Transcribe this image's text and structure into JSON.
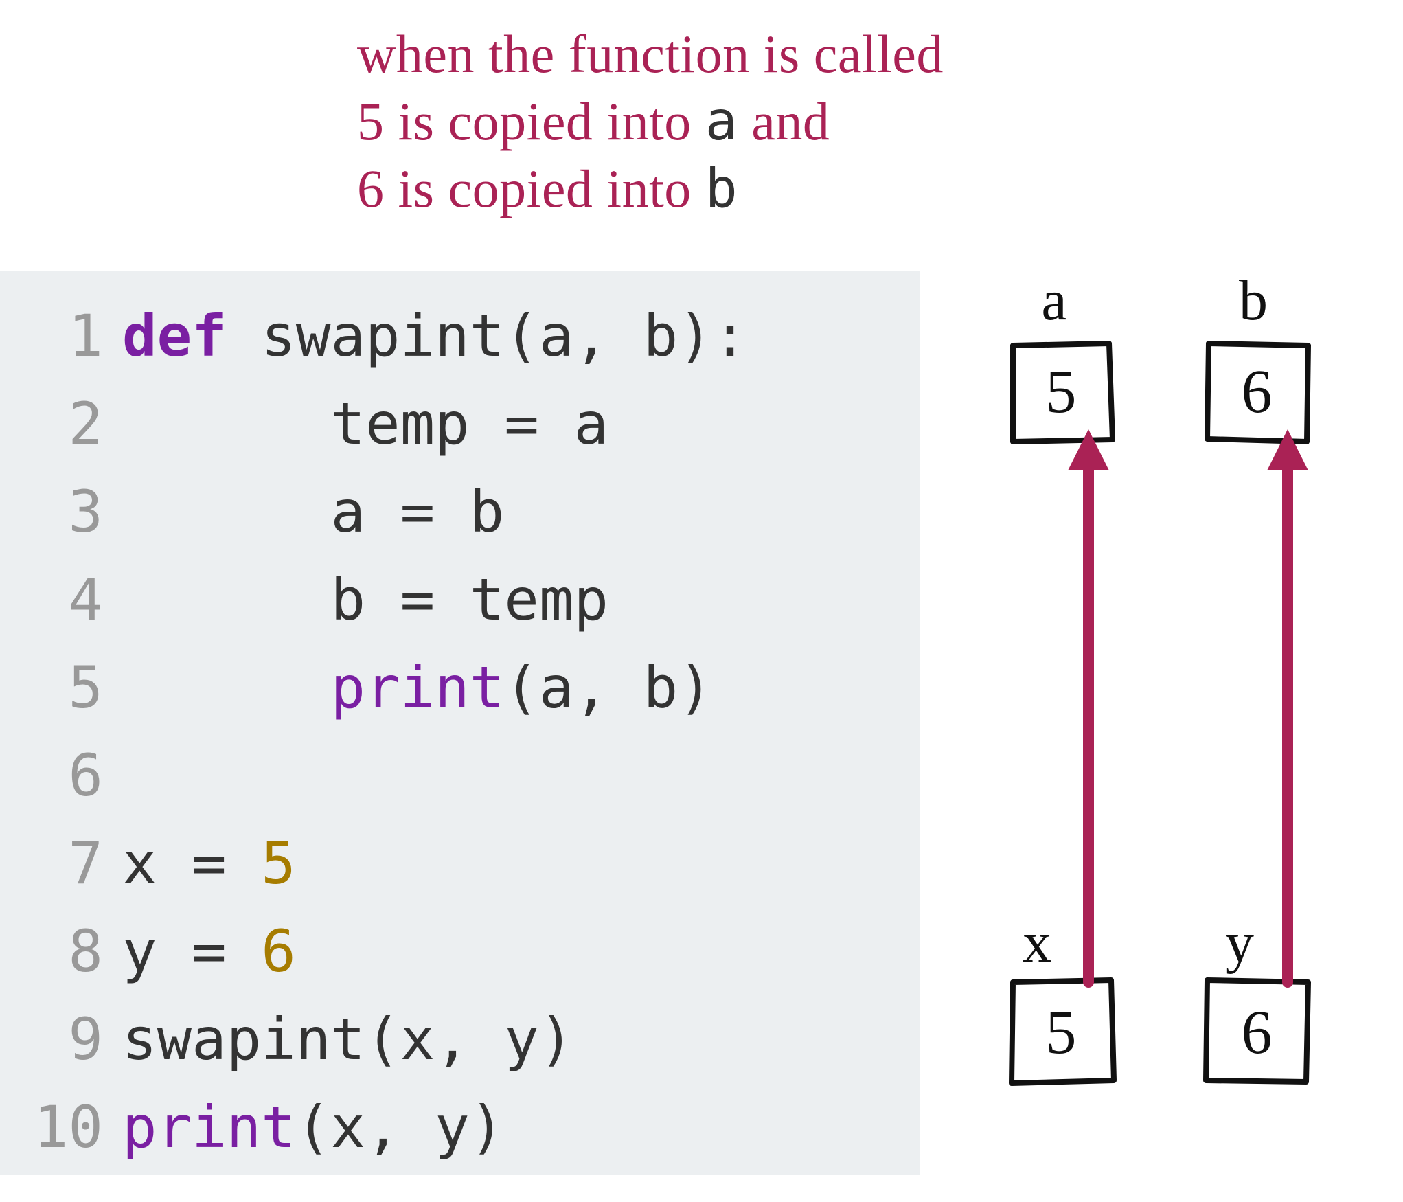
{
  "annotation": {
    "line1_pre": "when the function is called",
    "line2_pre": "5 is copied into ",
    "line2_var": "a",
    "line2_post": " and",
    "line3_pre": "6 is copied into ",
    "line3_var": "b"
  },
  "code": {
    "lines": [
      {
        "n": "1",
        "tokens": [
          [
            "kw",
            "def "
          ],
          [
            "id",
            "swapint"
          ],
          [
            "p",
            "("
          ],
          [
            "id",
            "a"
          ],
          [
            "p",
            ", "
          ],
          [
            "id",
            "b"
          ],
          [
            "p",
            "):"
          ]
        ]
      },
      {
        "n": "2",
        "tokens": [
          [
            "p",
            "      "
          ],
          [
            "id",
            "temp"
          ],
          [
            "op",
            " = "
          ],
          [
            "id",
            "a"
          ]
        ]
      },
      {
        "n": "3",
        "tokens": [
          [
            "p",
            "      "
          ],
          [
            "id",
            "a"
          ],
          [
            "op",
            " = "
          ],
          [
            "id",
            "b"
          ]
        ]
      },
      {
        "n": "4",
        "tokens": [
          [
            "p",
            "      "
          ],
          [
            "id",
            "b"
          ],
          [
            "op",
            " = "
          ],
          [
            "id",
            "temp"
          ]
        ]
      },
      {
        "n": "5",
        "tokens": [
          [
            "p",
            "      "
          ],
          [
            "call",
            "print"
          ],
          [
            "p",
            "("
          ],
          [
            "id",
            "a"
          ],
          [
            "p",
            ", "
          ],
          [
            "id",
            "b"
          ],
          [
            "p",
            ")"
          ]
        ]
      },
      {
        "n": "6",
        "tokens": []
      },
      {
        "n": "7",
        "tokens": [
          [
            "id",
            "x"
          ],
          [
            "op",
            " = "
          ],
          [
            "num",
            "5"
          ]
        ]
      },
      {
        "n": "8",
        "tokens": [
          [
            "id",
            "y"
          ],
          [
            "op",
            " = "
          ],
          [
            "num",
            "6"
          ]
        ]
      },
      {
        "n": "9",
        "tokens": [
          [
            "id",
            "swapint"
          ],
          [
            "p",
            "("
          ],
          [
            "id",
            "x"
          ],
          [
            "p",
            ", "
          ],
          [
            "id",
            "y"
          ],
          [
            "p",
            ")"
          ]
        ]
      },
      {
        "n": "10",
        "tokens": [
          [
            "call",
            "print"
          ],
          [
            "p",
            "("
          ],
          [
            "id",
            "x"
          ],
          [
            "p",
            ", "
          ],
          [
            "id",
            "y"
          ],
          [
            "p",
            ")"
          ]
        ]
      }
    ]
  },
  "diagram": {
    "label_a": "a",
    "label_b": "b",
    "label_x": "x",
    "label_y": "y",
    "box_a": "5",
    "box_b": "6",
    "box_x": "5",
    "box_y": "6",
    "arrow_color": "#aa2255"
  }
}
